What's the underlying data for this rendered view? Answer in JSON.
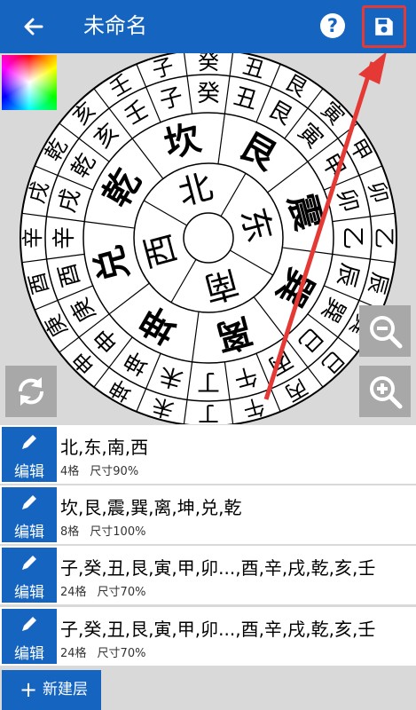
{
  "app_bar": {
    "title": "未命名",
    "help_label": "?",
    "accent": "#1565c0",
    "highlight": "#e53935"
  },
  "icons": {
    "back": "arrow-left-icon",
    "help": "help-icon",
    "save": "save-icon",
    "rotate": "rotate-icon",
    "zoom_out": "zoom-out-icon",
    "zoom_in": "zoom-in-icon",
    "edit": "pencil-icon",
    "add": "plus-icon"
  },
  "wheel": {
    "ring1": [
      "北",
      "东",
      "南",
      "西"
    ],
    "ring2": [
      "坎",
      "艮",
      "震",
      "巽",
      "离",
      "坤",
      "兑",
      "乾"
    ],
    "ring3": [
      "子",
      "癸",
      "丑",
      "艮",
      "寅",
      "甲",
      "卯",
      "乙",
      "辰",
      "巽",
      "巳",
      "丙",
      "午",
      "丁",
      "未",
      "坤",
      "申",
      "庚",
      "酉",
      "辛",
      "戌",
      "乾",
      "亥",
      "壬"
    ],
    "ring4": [
      "子",
      "癸",
      "丑",
      "艮",
      "寅",
      "甲",
      "卯",
      "乙",
      "辰",
      "巽",
      "巳",
      "丙",
      "午",
      "丁",
      "未",
      "坤",
      "申",
      "庚",
      "酉",
      "辛",
      "戌",
      "乾",
      "亥",
      "壬"
    ]
  },
  "layers": [
    {
      "text": "北,东,南,西",
      "count": "4格",
      "size": "尺寸90%",
      "edit_label": "编辑"
    },
    {
      "text": "坎,艮,震,巽,离,坤,兑,乾",
      "count": "8格",
      "size": "尺寸100%",
      "edit_label": "编辑"
    },
    {
      "text": "子,癸,丑,艮,寅,甲,卯...,酉,辛,戌,乾,亥,壬",
      "count": "24格",
      "size": "尺寸70%",
      "edit_label": "编辑"
    },
    {
      "text": "子,癸,丑,艮,寅,甲,卯...,酉,辛,戌,乾,亥,壬",
      "count": "24格",
      "size": "尺寸70%",
      "edit_label": "编辑"
    }
  ],
  "new_layer": {
    "label": "新建层"
  }
}
